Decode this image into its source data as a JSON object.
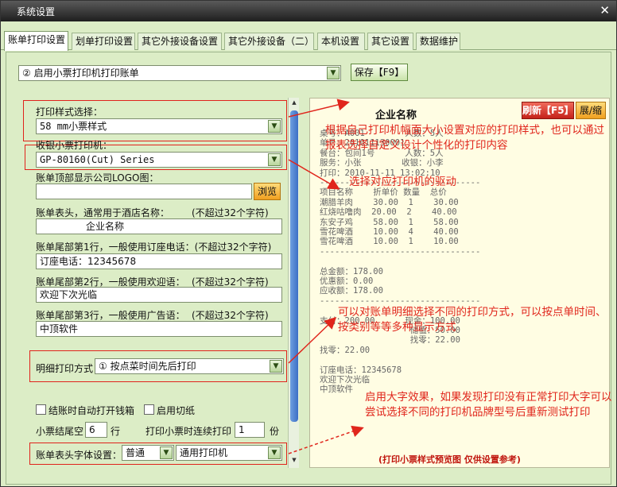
{
  "window": {
    "title": "系统设置",
    "close_glyph": "✕"
  },
  "tabs": [
    "账单打印设置",
    "划单打印设置",
    "其它外接设备设置",
    "其它外接设备（二）",
    "本机设置",
    "其它设置",
    "数据维护"
  ],
  "top_bar": {
    "print_mode_value": "② 启用小票打印机打印账单",
    "save_label": "保存【F9】"
  },
  "form": {
    "print_style_label": "打印样式选择：",
    "print_style_value": "58  mm小票样式",
    "printer_label": "收银小票打印机：",
    "printer_value": "GP-80160(Cut) Series",
    "logo_label": "账单顶部显示公司LOGO图：",
    "logo_value": "",
    "browse_label": "浏览",
    "header_label": "账单表头，通常用于酒店名称：",
    "header_limit": "(不超过32个字符)",
    "header_value": "企业名称",
    "footer1_label": "账单尾部第1行，一般使用订座电话：(不超过32个字符)",
    "footer1_value": "订座电话：12345678",
    "footer2_label": "账单尾部第2行，一般使用欢迎语：",
    "footer2_limit": "(不超过32个字符)",
    "footer2_value": "欢迎下次光临",
    "footer3_label": "账单尾部第3行，一般使用广告语：",
    "footer3_limit": "(不超过32个字符)",
    "footer3_value": "中顶软件",
    "detail_label": "明细打印方式",
    "detail_value": "① 按点菜时间先后打印",
    "auto_drawer_label": "结账时自动打开钱箱",
    "cutter_label": "启用切纸",
    "tail_blank_label": "小票结尾空",
    "tail_blank_value": "6",
    "tail_blank_unit": "行",
    "copies_label": "打印小票时连续打印",
    "copies_value": "1",
    "copies_unit": "份",
    "font_label": "账单表头字体设置：",
    "font_size_value": "普通",
    "font_printer_value": "通用打印机"
  },
  "preview": {
    "refresh_label": "刷新【F5】",
    "expand_label": "展/缩",
    "company": "企业名称",
    "receipt_lines": [
      "桌号：A001        人数：5人",
      "单号：201011130001",
      "餐台：包间1号      人数：5人",
      "服务：小张        收银：小李",
      "打印：2010-11-11 13:02:10",
      "--------------------------------",
      "项目名称    折单价 数量  总价",
      "潮腊羊肉    30.00  1    30.00",
      "红烧咕噜肉  20.00  2    40.00",
      "东安子鸡    58.00  1    58.00",
      "雪花啤酒    10.00  4    40.00",
      "雪花啤酒    10.00  1    10.00",
      "--------------------------------",
      "",
      "总金额：178.00",
      "优惠额：0.00",
      "应收额：178.00",
      "--------------------------------",
      "",
      "支付：200.00      现金：100.00",
      "                  储值：50.00",
      "                  找零：22.00",
      "找零：22.00",
      "",
      "订座电话：12345678",
      "欢迎下次光临",
      "中顶软件"
    ],
    "caption": "(打印小票样式预览图 仅供设置参考)"
  },
  "annotations": {
    "a1": "根据自己打印机幅面大小设置对应的打印样式，也可以通过报表选择自定义设计个性化的打印内容",
    "a2": "选择对应打印机的驱动",
    "a3": "可以对账单明细选择不同的打印方式，可以按点单时间、按类别等等多种显示方式",
    "a4": "启用大字效果，如果发现打印没有正常打印大字可以尝试选择不同的打印机品牌型号后重新测试打印"
  },
  "colors": {
    "panel_bg": "#dcedc6",
    "annotation_red": "#e0261c",
    "preview_bg": "#fffde3"
  }
}
